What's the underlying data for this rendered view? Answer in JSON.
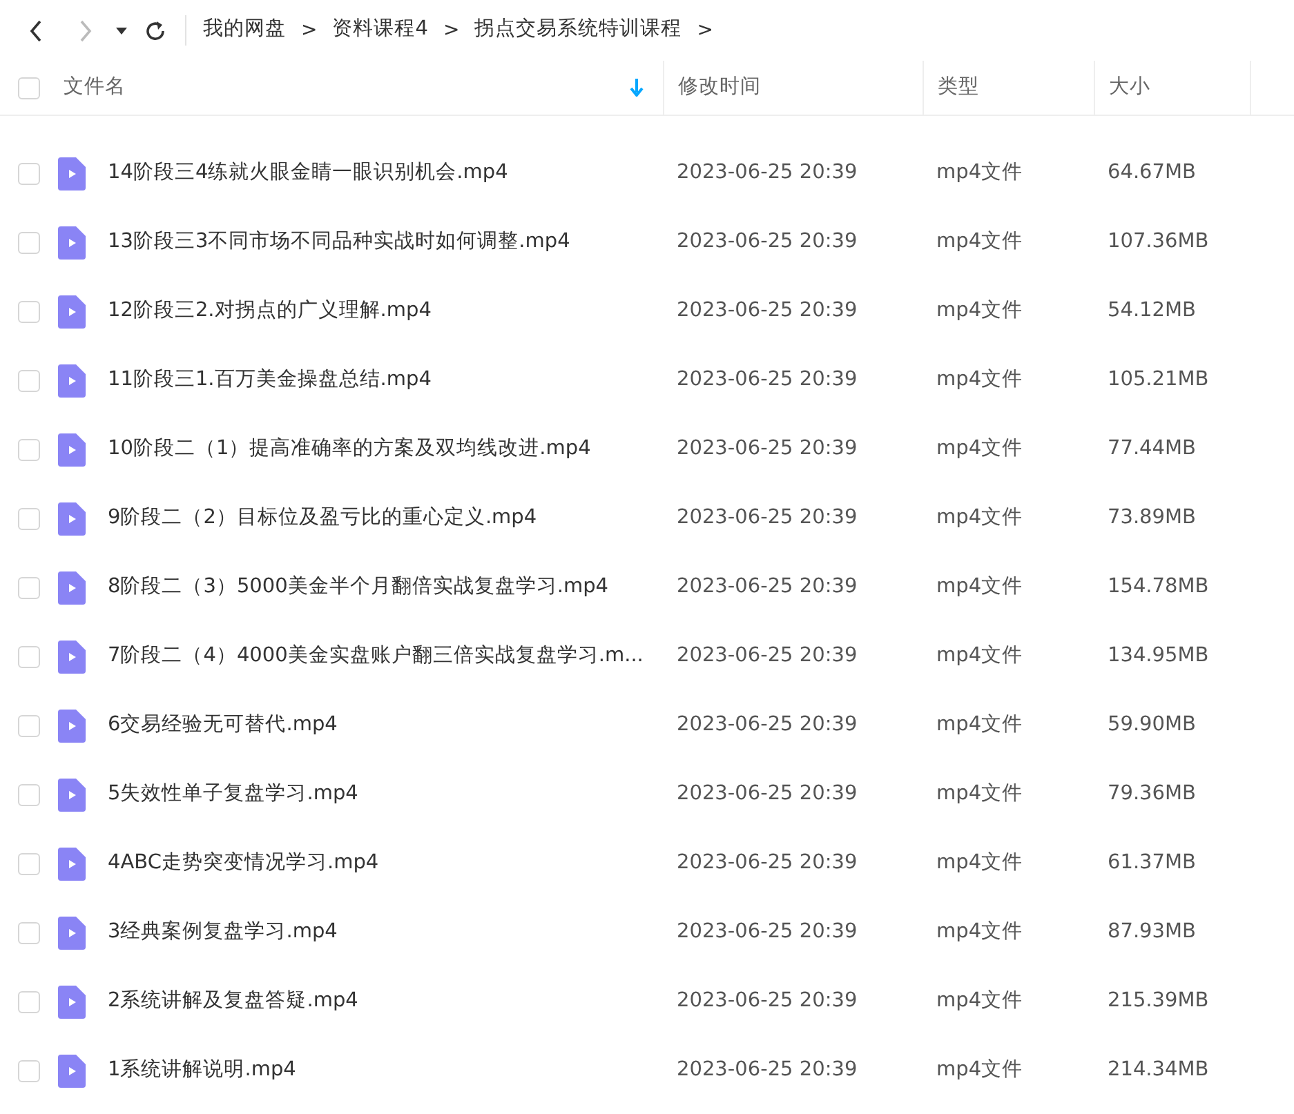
{
  "breadcrumb": [
    "我的网盘",
    "资料课程4",
    "拐点交易系统特训课程"
  ],
  "breadcrumb_separator": ">",
  "table": {
    "select_all_checked": false,
    "columns": [
      {
        "label": "文件名",
        "sorted": true
      },
      {
        "label": "修改时间",
        "sorted": false
      },
      {
        "label": "类型",
        "sorted": false
      },
      {
        "label": "大小",
        "sorted": false
      }
    ],
    "rows": [
      {
        "checked": false,
        "name": "14阶段三4练就火眼金睛一眼识别机会.mp4",
        "modified": "2023-06-25 20:39",
        "type": "mp4文件",
        "size": "64.67MB"
      },
      {
        "checked": false,
        "name": "13阶段三3不同市场不同品种实战时如何调整.mp4",
        "modified": "2023-06-25 20:39",
        "type": "mp4文件",
        "size": "107.36MB"
      },
      {
        "checked": false,
        "name": "12阶段三2.对拐点的广义理解.mp4",
        "modified": "2023-06-25 20:39",
        "type": "mp4文件",
        "size": "54.12MB"
      },
      {
        "checked": false,
        "name": "11阶段三1.百万美金操盘总结.mp4",
        "modified": "2023-06-25 20:39",
        "type": "mp4文件",
        "size": "105.21MB"
      },
      {
        "checked": false,
        "name": "10阶段二（1）提高准确率的方案及双均线改进.mp4",
        "modified": "2023-06-25 20:39",
        "type": "mp4文件",
        "size": "77.44MB"
      },
      {
        "checked": false,
        "name": "9阶段二（2）目标位及盈亏比的重心定义.mp4",
        "modified": "2023-06-25 20:39",
        "type": "mp4文件",
        "size": "73.89MB"
      },
      {
        "checked": false,
        "name": "8阶段二（3）5000美金半个月翻倍实战复盘学习.mp4",
        "modified": "2023-06-25 20:39",
        "type": "mp4文件",
        "size": "154.78MB"
      },
      {
        "checked": false,
        "name": "7阶段二（4）4000美金实盘账户翻三倍实战复盘学习.m...",
        "modified": "2023-06-25 20:39",
        "type": "mp4文件",
        "size": "134.95MB"
      },
      {
        "checked": false,
        "name": "6交易经验无可替代.mp4",
        "modified": "2023-06-25 20:39",
        "type": "mp4文件",
        "size": "59.90MB"
      },
      {
        "checked": false,
        "name": "5失效性单子复盘学习.mp4",
        "modified": "2023-06-25 20:39",
        "type": "mp4文件",
        "size": "79.36MB"
      },
      {
        "checked": false,
        "name": "4ABC走势突变情况学习.mp4",
        "modified": "2023-06-25 20:39",
        "type": "mp4文件",
        "size": "61.37MB"
      },
      {
        "checked": false,
        "name": "3经典案例复盘学习.mp4",
        "modified": "2023-06-25 20:39",
        "type": "mp4文件",
        "size": "87.93MB"
      },
      {
        "checked": false,
        "name": "2系统讲解及复盘答疑.mp4",
        "modified": "2023-06-25 20:39",
        "type": "mp4文件",
        "size": "215.39MB"
      },
      {
        "checked": false,
        "name": "1系统讲解说明.mp4",
        "modified": "2023-06-25 20:39",
        "type": "mp4文件",
        "size": "214.34MB"
      }
    ]
  }
}
